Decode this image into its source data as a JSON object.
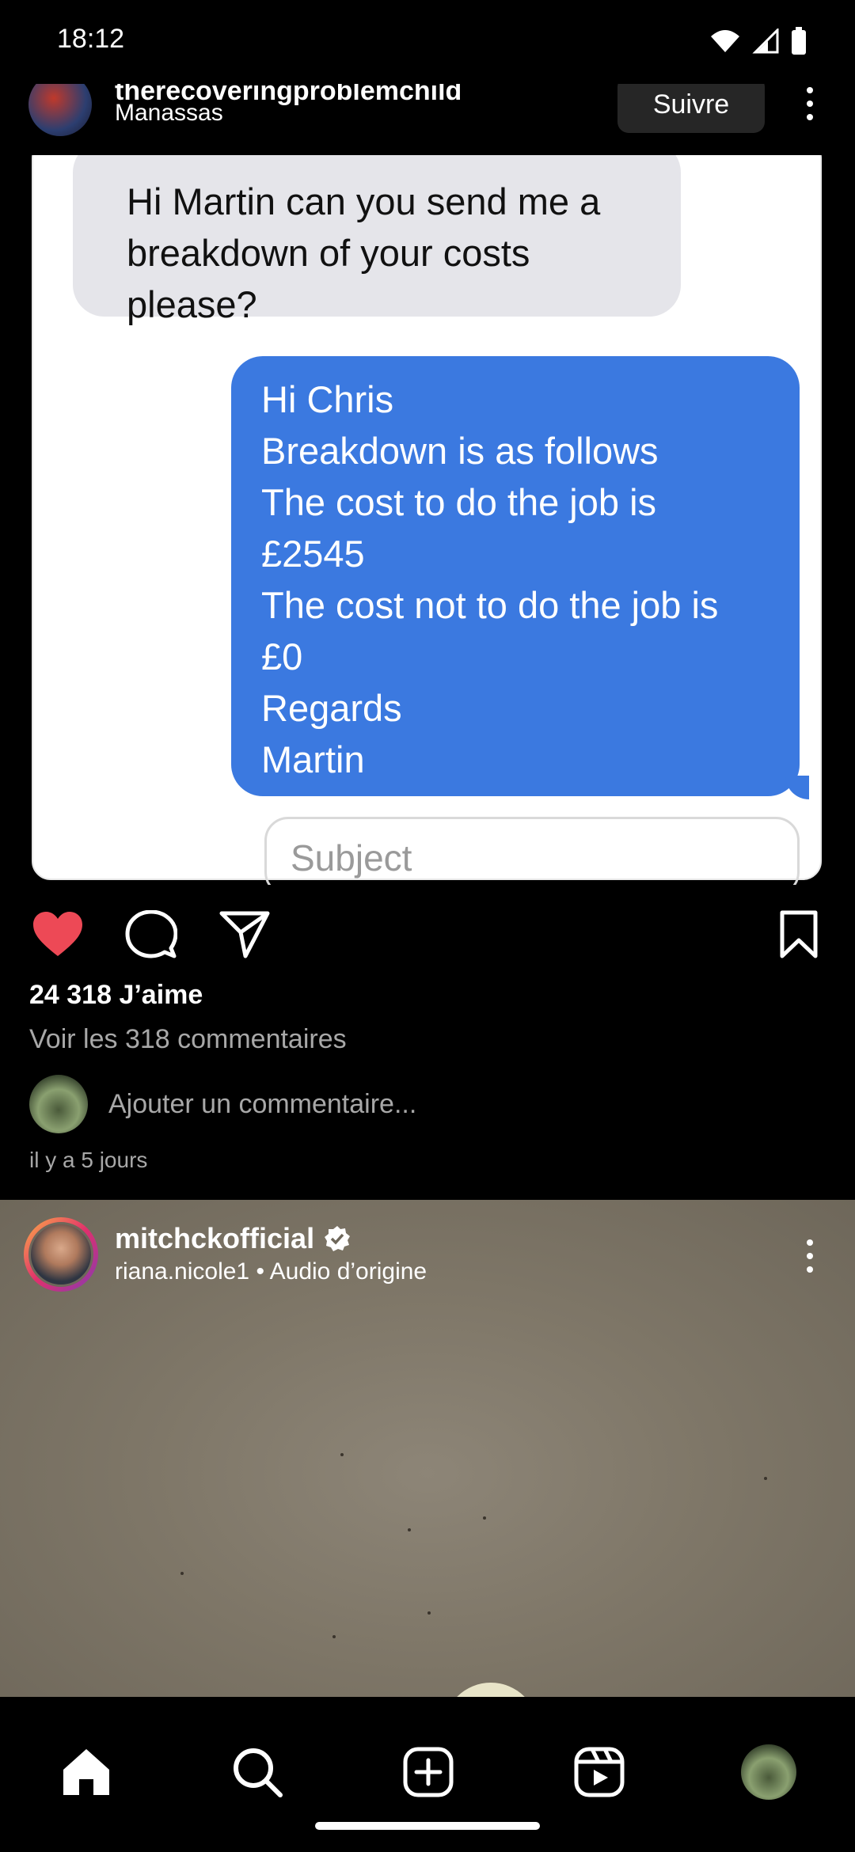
{
  "status_bar": {
    "time": "18:12",
    "icons": [
      "wifi-icon",
      "signal-icon",
      "battery-icon"
    ]
  },
  "post1": {
    "username": "therecoveringproblemchild",
    "location": "Manassas",
    "follow_label": "Suivre",
    "image": {
      "incoming_message": "Hi Martin can you send me a breakdown of your costs please?",
      "outgoing_lines": [
        "Hi Chris",
        "Breakdown is as follows",
        "The cost to do the job is",
        "£2545",
        "The cost not to do the job is",
        "£0",
        "Regards",
        "Martin"
      ],
      "subject_placeholder": "Subject"
    },
    "likes": "24 318 J’aime",
    "view_comments": "Voir les 318 commentaires",
    "comment_placeholder": "Ajouter un commentaire...",
    "time_ago": "il y a 5 jours",
    "liked": true,
    "accent_like": "#ed4956"
  },
  "post2": {
    "username": "mitchckofficial",
    "verified": true,
    "subtitle": "riana.nicole1 • Audio d’origine"
  },
  "bottom_nav": {
    "items": [
      "home-icon",
      "search-icon",
      "create-icon",
      "reels-icon",
      "profile-avatar"
    ]
  }
}
